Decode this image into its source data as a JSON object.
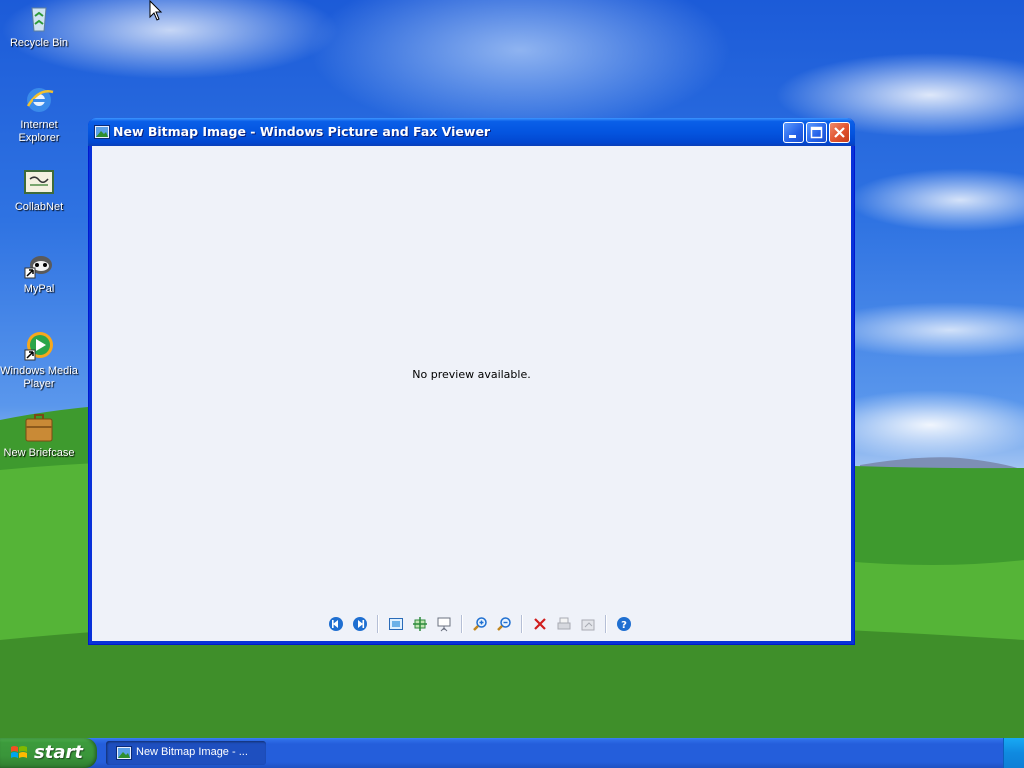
{
  "desktop": {
    "icons": [
      {
        "label": "Recycle Bin",
        "icon": "recycle-bin-icon"
      },
      {
        "label": "Internet Explorer",
        "icon": "internet-explorer-icon"
      },
      {
        "label": "CollabNet",
        "icon": "collabnet-icon"
      },
      {
        "label": "MyPal",
        "icon": "mypal-icon"
      },
      {
        "label": "Windows Media Player",
        "icon": "windows-media-player-icon"
      },
      {
        "label": "New Briefcase",
        "icon": "briefcase-icon"
      }
    ]
  },
  "window": {
    "title": "New Bitmap Image - Windows Picture and Fax Viewer",
    "message": "No preview available.",
    "toolbar": [
      {
        "name": "previous-image-button",
        "icon": "previous-icon"
      },
      {
        "name": "next-image-button",
        "icon": "next-icon"
      },
      {
        "name": "best-fit-button",
        "icon": "best-fit-icon"
      },
      {
        "name": "actual-size-button",
        "icon": "actual-size-icon"
      },
      {
        "name": "slideshow-button",
        "icon": "slideshow-icon"
      },
      {
        "name": "zoom-in-button",
        "icon": "zoom-in-icon"
      },
      {
        "name": "zoom-out-button",
        "icon": "zoom-out-icon"
      },
      {
        "name": "delete-button",
        "icon": "delete-icon"
      },
      {
        "name": "print-button",
        "icon": "print-icon"
      },
      {
        "name": "copy-to-button",
        "icon": "copy-to-icon"
      },
      {
        "name": "help-button",
        "icon": "help-icon"
      }
    ]
  },
  "taskbar": {
    "start_label": "start",
    "task_item_label": "New Bitmap Image - ..."
  },
  "colors": {
    "titlebar": "#0455e0",
    "client_bg": "#eff2f9",
    "taskbar": "#245edb",
    "start_button": "#3a953a",
    "close_button": "#e0532f"
  }
}
